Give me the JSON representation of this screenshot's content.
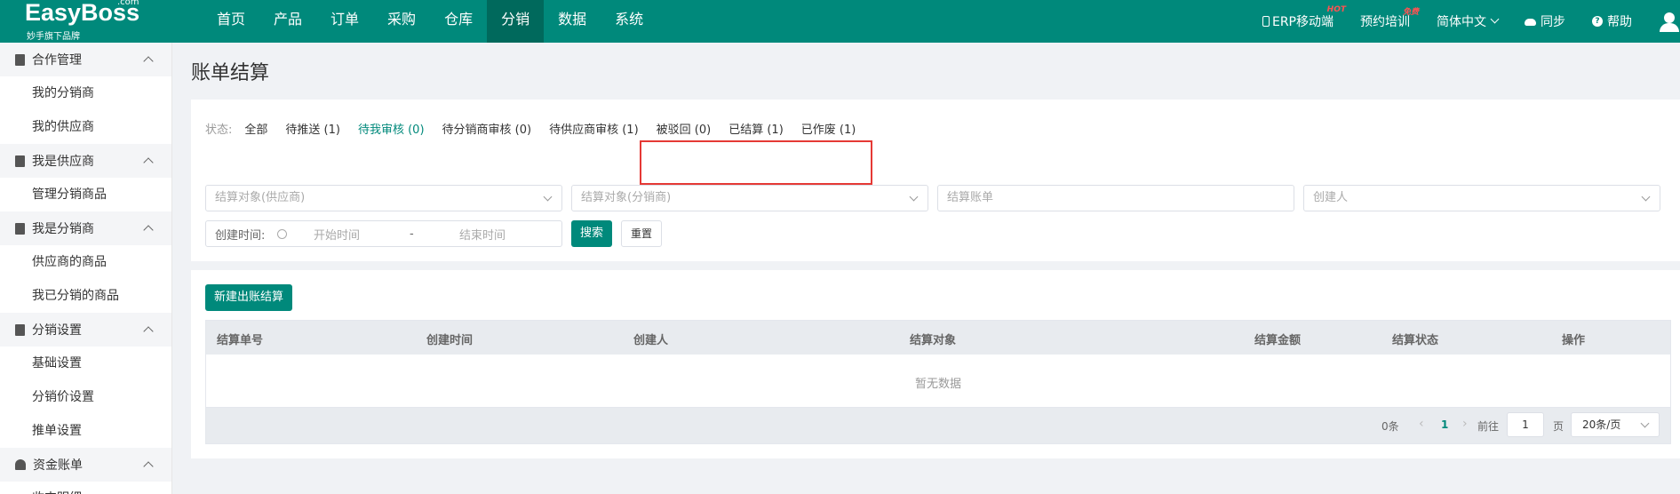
{
  "brand": {
    "name": "EasyBoss",
    "suffix": ".com",
    "slogan": "妙手旗下品牌"
  },
  "nav": [
    "首页",
    "产品",
    "订单",
    "采购",
    "仓库",
    "分销",
    "数据",
    "系统"
  ],
  "topright": {
    "erp": "ERP移动端",
    "erp_badge": "HOT",
    "training": "预约培训",
    "training_badge": "免费",
    "language": "简体中文",
    "sync": "同步",
    "help": "帮助"
  },
  "sidebar": {
    "groups": [
      {
        "title": "合作管理",
        "items": [
          "我的分销商",
          "我的供应商"
        ]
      },
      {
        "title": "我是供应商",
        "items": [
          "管理分销商品"
        ]
      },
      {
        "title": "我是分销商",
        "items": [
          "供应商的商品",
          "我已分销的商品"
        ]
      },
      {
        "title": "分销设置",
        "items": [
          "基础设置",
          "分销价设置",
          "推单设置"
        ]
      },
      {
        "title": "资金账单",
        "items": [
          "收支明细"
        ]
      }
    ]
  },
  "page": {
    "title": "账单结算"
  },
  "status": {
    "label": "状态:",
    "tabs": [
      "全部",
      "待推送 (1)",
      "待我审核 (0)",
      "待分销商审核 (0)",
      "待供应商审核 (1)",
      "被驳回 (0)",
      "已结算 (1)",
      "已作废 (1)"
    ]
  },
  "filters": {
    "supplier_placeholder": "结算对象(供应商)",
    "distributor_placeholder": "结算对象(分销商)",
    "bill_placeholder": "结算账单",
    "creator_placeholder": "创建人",
    "date_label": "创建时间:",
    "start_placeholder": "开始时间",
    "separator": "-",
    "end_placeholder": "结束时间",
    "search": "搜索",
    "reset": "重置"
  },
  "actions": {
    "create": "新建出账结算"
  },
  "table": {
    "columns": [
      "结算单号",
      "创建时间",
      "创建人",
      "结算对象",
      "结算金额",
      "结算状态",
      "操作"
    ],
    "empty": "暂无数据"
  },
  "pagination": {
    "total": "0条",
    "prev": "‹",
    "current": "1",
    "next": "›",
    "goto_label": "前往",
    "goto_value": "1",
    "page_unit": "页",
    "page_size": "20条/页"
  },
  "colors": {
    "primary": "#00897b",
    "primary_dark": "#00695c",
    "highlight_box": "#e53935"
  }
}
